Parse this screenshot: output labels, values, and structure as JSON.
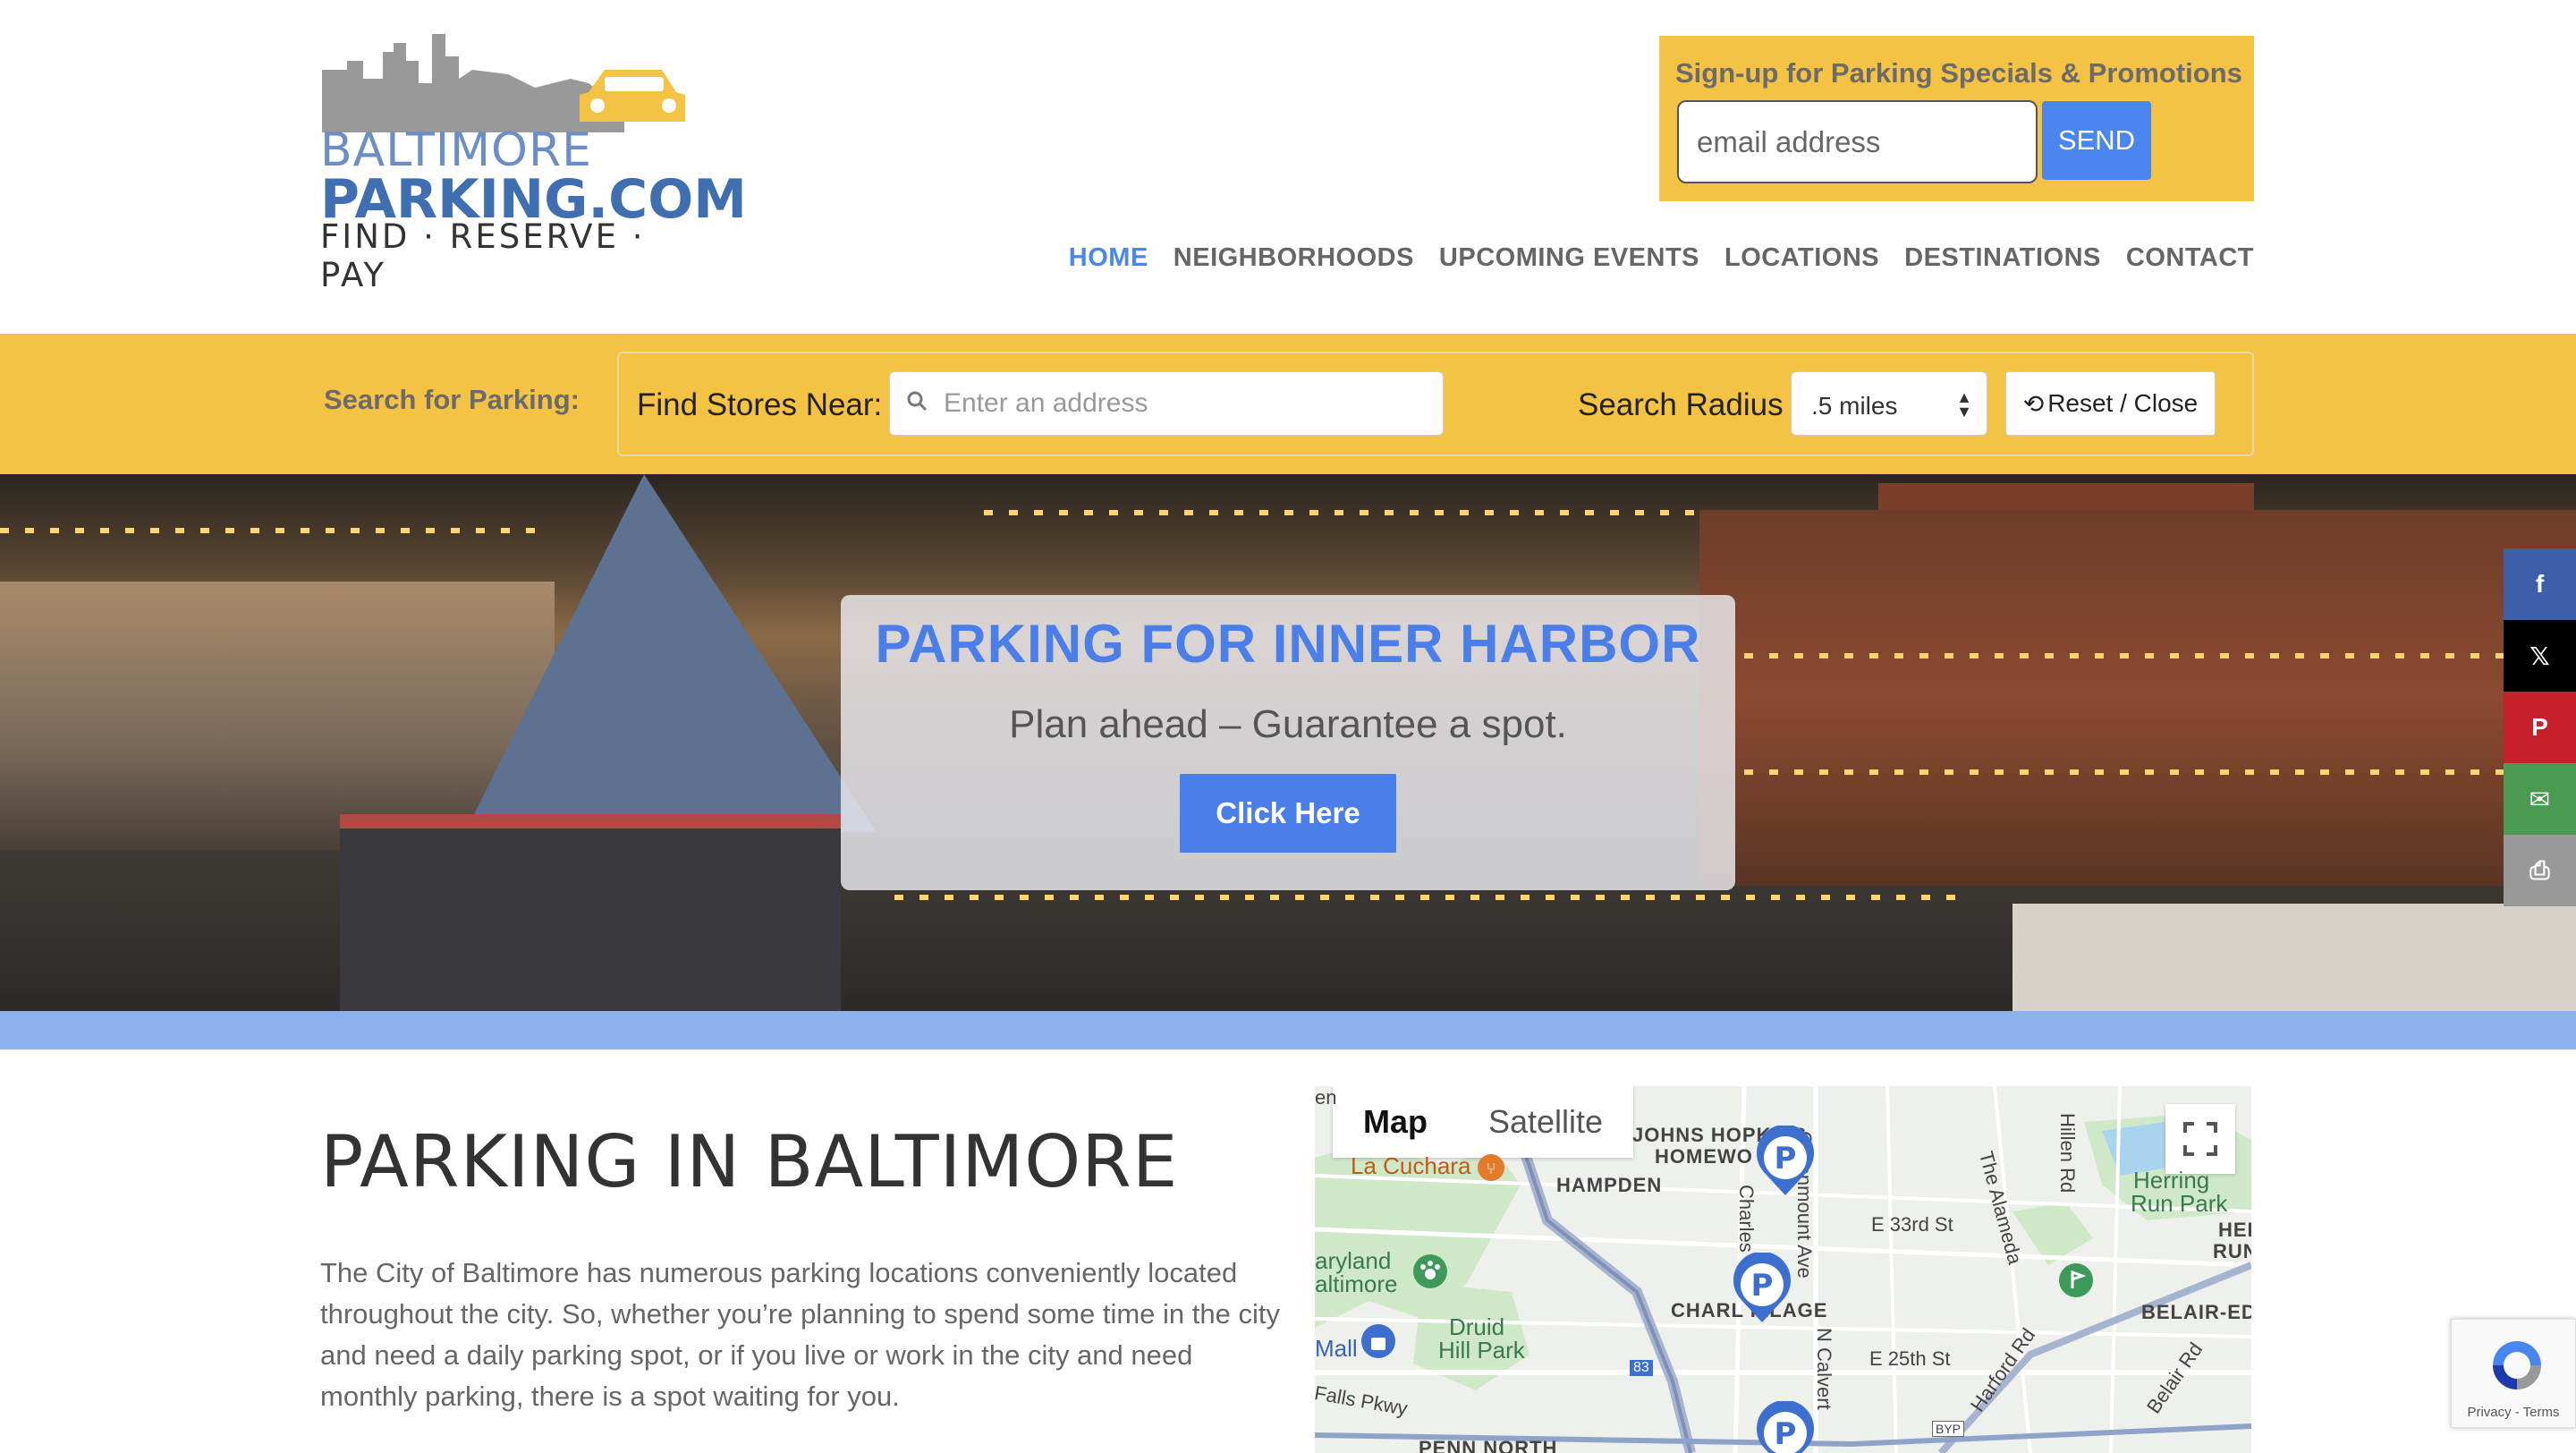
{
  "logo": {
    "line1": "BALTIMORE",
    "line2": "PARKING.COM",
    "tagline": "FIND · RESERVE · PAY"
  },
  "signup": {
    "title": "Sign-up for Parking Specials & Promotions",
    "email_placeholder": "email address",
    "send_label": "SEND"
  },
  "nav": {
    "items": [
      "HOME",
      "NEIGHBORHOODS",
      "UPCOMING EVENTS",
      "LOCATIONS",
      "DESTINATIONS",
      "CONTACT"
    ],
    "active": "HOME"
  },
  "search": {
    "label": "Search for Parking:",
    "find_label": "Find Stores Near:",
    "address_placeholder": "Enter an address",
    "radius_label": "Search Radius",
    "radius_value": ".5 miles",
    "reset_label": "Reset / Close"
  },
  "hero": {
    "title": "PARKING FOR INNER HARBOR",
    "subtitle": "Plan ahead – Guarantee a spot.",
    "cta": "Click Here"
  },
  "social": [
    "facebook-icon",
    "x-icon",
    "pinterest-icon",
    "email-icon",
    "print-icon"
  ],
  "content": {
    "heading": "PARKING IN BALTIMORE",
    "paragraph": "The City of Baltimore has numerous parking locations conveniently located throughout the city. So, whether you’re planning to spend some time in the city and need a daily parking spot, or if you live or work in the city and need monthly parking, there is a spot waiting for you."
  },
  "map": {
    "tab_map": "Map",
    "tab_satellite": "Satellite",
    "labels": {
      "en": "en",
      "johns_hopkins": "JOHNS HOPKINS",
      "homewood": "HOMEWO",
      "la_cuchara": "La Cuchara",
      "hampden": "HAMPDEN",
      "greenmount": "Greenmount Ave",
      "alameda": "The Alameda",
      "hillen": "Hillen Rd",
      "herring1": "Herring",
      "herring2": "Run Park",
      "her": "HER",
      "run": "RUN",
      "charles": "Charles",
      "e33": "E 33rd St",
      "maryland1": "aryland",
      "maryland2": "altimore",
      "charles_village": "CHARL    ILLAGE",
      "belair_ed": "BELAIR-ED",
      "druid1": "Druid",
      "druid2": "Hill Park",
      "mall": "Mall",
      "ncalvert": "N Calvert",
      "e25": "E 25th St",
      "harford": "Harford Rd",
      "belair_rd": "Belair Rd",
      "falls": "Falls Pkwy",
      "i83": "83",
      "byp": "BYP",
      "penn_north": "PENN NORTH"
    }
  },
  "recaptcha": {
    "terms": "Privacy - Terms"
  },
  "colors": {
    "accent_blue": "#4a86ef",
    "yellow": "#f5c343",
    "band_blue": "#8cb2ee"
  }
}
